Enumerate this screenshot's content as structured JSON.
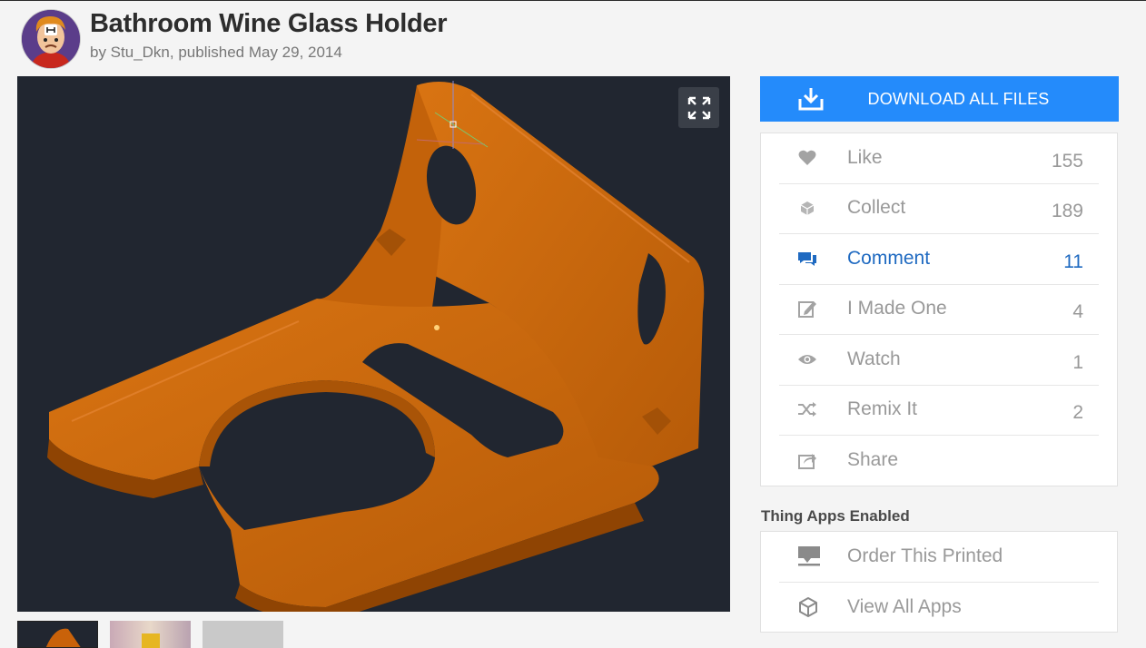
{
  "header": {
    "title": "Bathroom Wine Glass Holder",
    "byline": "by Stu_Dkn, published May 29, 2014"
  },
  "download": {
    "label": "DOWNLOAD ALL FILES"
  },
  "actions": [
    {
      "label": "Like",
      "count": "155",
      "icon": "heart-icon"
    },
    {
      "label": "Collect",
      "count": "189",
      "icon": "collect-icon"
    },
    {
      "label": "Comment",
      "count": "11",
      "icon": "comment-icon",
      "active": true
    },
    {
      "label": "I Made One",
      "count": "4",
      "icon": "made-one-icon"
    },
    {
      "label": "Watch",
      "count": "1",
      "icon": "eye-icon"
    },
    {
      "label": "Remix It",
      "count": "2",
      "icon": "remix-icon"
    },
    {
      "label": "Share",
      "count": "",
      "icon": "share-icon"
    }
  ],
  "apps": {
    "heading": "Thing Apps Enabled",
    "items": [
      {
        "label": "Order This Printed",
        "icon": "printer-icon"
      },
      {
        "label": "View All Apps",
        "icon": "cube-icon"
      }
    ]
  },
  "colors": {
    "accent": "#248bfb",
    "active_text": "#1f6ac1",
    "viewer_bg": "#212630",
    "model": "#c9620a"
  }
}
